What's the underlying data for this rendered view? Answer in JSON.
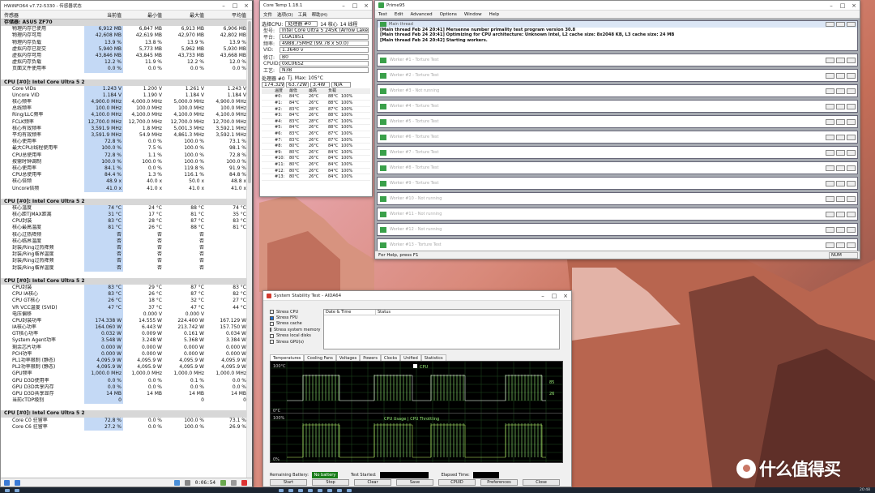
{
  "hwinfo": {
    "title": "HWiNFO64 v7.72-5330 - 传感器状态",
    "columns": [
      "传感器",
      "当前值",
      "最小值",
      "最大值",
      "平均值"
    ],
    "rows": [
      {
        "type": "sec",
        "cells": [
          "存储器: ASUS ZF70",
          "",
          "",
          "",
          ""
        ]
      },
      {
        "cells": [
          "物理内存已使用",
          "6,912 MB",
          "6,847 MB",
          "6,913 MB",
          "6,906 MB"
        ]
      },
      {
        "cells": [
          "物理内存可用",
          "42,608 MB",
          "42,619 MB",
          "42,970 MB",
          "42,802 MB"
        ]
      },
      {
        "cells": [
          "物理内存负载",
          "13.9 %",
          "13.8 %",
          "13.9 %",
          "13.9 %"
        ]
      },
      {
        "cells": [
          "虚拟内存已提交",
          "5,940 MB",
          "5,773 MB",
          "5,962 MB",
          "5,930 MB"
        ]
      },
      {
        "cells": [
          "虚拟内存可用",
          "43,846 MB",
          "43,845 MB",
          "43,733 MB",
          "43,668 MB"
        ]
      },
      {
        "cells": [
          "虚拟内存负载",
          "12.2 %",
          "11.9 %",
          "12.2 %",
          "12.0 %"
        ]
      },
      {
        "cells": [
          "页面文件使用率",
          "0.0 %",
          "0.0 %",
          "0.0 %",
          "0.0 %"
        ]
      },
      {
        "type": "blank",
        "cells": [
          "",
          "",
          "",
          "",
          ""
        ]
      },
      {
        "type": "sec",
        "cells": [
          "CPU [#0]: Intel Core Ultra 5 245K",
          "",
          "",
          "",
          ""
        ]
      },
      {
        "cells": [
          "Core VIDs",
          "1.243 V",
          "1.200 V",
          "1.261 V",
          "1.243 V"
        ]
      },
      {
        "cells": [
          "Uncore VID",
          "1.184 V",
          "1.190 V",
          "1.184 V",
          "1.184 V"
        ]
      },
      {
        "cells": [
          "核心频率",
          "4,900.0 MHz",
          "4,000.0 MHz",
          "5,000.0 MHz",
          "4,900.0 MHz"
        ]
      },
      {
        "cells": [
          "总线频率",
          "100.0 MHz",
          "100.0 MHz",
          "100.0 MHz",
          "100.0 MHz"
        ]
      },
      {
        "cells": [
          "Ring/LLC频率",
          "4,100.0 MHz",
          "4,100.0 MHz",
          "4,100.0 MHz",
          "4,100.0 MHz"
        ]
      },
      {
        "cells": [
          "FCLK频率",
          "12,700.0 MHz",
          "12,700.0 MHz",
          "12,700.0 MHz",
          "12,700.0 MHz"
        ]
      },
      {
        "cells": [
          "核心有效频率",
          "3,591.9 MHz",
          "1.8 MHz",
          "5,001.3 MHz",
          "3,592.1 MHz"
        ]
      },
      {
        "cells": [
          "平均有效频率",
          "3,591.9 MHz",
          "54.9 MHz",
          "4,861.3 MHz",
          "3,592.1 MHz"
        ]
      },
      {
        "cells": [
          "核心使用率",
          "72.8 %",
          "0.0 %",
          "100.0 %",
          "73.1 %"
        ]
      },
      {
        "cells": [
          "最大CPU/线程使用率",
          "100.0 %",
          "7.5 %",
          "100.0 %",
          "98.1 %"
        ]
      },
      {
        "cells": [
          "CPU总使用率",
          "72.8 %",
          "1.1 %",
          "100.0 %",
          "72.8 %"
        ]
      },
      {
        "cells": [
          "按需时钟调制",
          "100.0 %",
          "100.0 %",
          "100.0 %",
          "100.0 %"
        ]
      },
      {
        "cells": [
          "核心使用率",
          "84.1 %",
          "0.0 %",
          "119.8 %",
          "91.9 %"
        ]
      },
      {
        "cells": [
          "CPU总使用率",
          "84.4 %",
          "1.3 %",
          "116.1 %",
          "84.8 %"
        ]
      },
      {
        "cells": [
          "核心倍频",
          "48.9 x",
          "40.0 x",
          "50.0 x",
          "48.8 x"
        ]
      },
      {
        "cells": [
          "Uncore倍频",
          "41.0 x",
          "41.0 x",
          "41.0 x",
          "41.0 x"
        ]
      },
      {
        "type": "blank",
        "cells": [
          "",
          "",
          "",
          "",
          ""
        ]
      },
      {
        "type": "sec",
        "cells": [
          "CPU [#0]: Intel Core Ultra 5 245K: DTS",
          "",
          "",
          "",
          ""
        ]
      },
      {
        "cells": [
          "核心温度",
          "74 °C",
          "24 °C",
          "88 °C",
          "74 °C"
        ]
      },
      {
        "cells": [
          "核心距TjMAX距离",
          "31 °C",
          "17 °C",
          "81 °C",
          "35 °C"
        ]
      },
      {
        "cells": [
          "CPU封装",
          "83 °C",
          "28 °C",
          "87 °C",
          "83 °C"
        ]
      },
      {
        "cells": [
          "核心最高温度",
          "81 °C",
          "26 °C",
          "88 °C",
          "81 °C"
        ]
      },
      {
        "cells": [
          "核心过热降频",
          "否",
          "否",
          "否",
          ""
        ]
      },
      {
        "cells": [
          "核心临界温度",
          "否",
          "否",
          "否",
          ""
        ]
      },
      {
        "cells": [
          "封装/Ring过热降频",
          "否",
          "否",
          "否",
          ""
        ]
      },
      {
        "cells": [
          "封装/Ring临界温度",
          "否",
          "否",
          "否",
          ""
        ]
      },
      {
        "cells": [
          "封装/Ring过热降频",
          "否",
          "否",
          "否",
          ""
        ]
      },
      {
        "cells": [
          "封装/Ring临界温度",
          "否",
          "否",
          "否",
          ""
        ]
      },
      {
        "type": "blank",
        "cells": [
          "",
          "",
          "",
          "",
          ""
        ]
      },
      {
        "type": "sec",
        "cells": [
          "CPU [#0]: Intel Core Ultra 5 245K: Enhanced",
          "",
          "",
          "",
          ""
        ]
      },
      {
        "cells": [
          "CPU封装",
          "83 °C",
          "29 °C",
          "87 °C",
          "83 °C"
        ]
      },
      {
        "cells": [
          "CPU IA核心",
          "83 °C",
          "26 °C",
          "87 °C",
          "82 °C"
        ]
      },
      {
        "cells": [
          "CPU GT核心",
          "26 °C",
          "18 °C",
          "32 °C",
          "27 °C"
        ]
      },
      {
        "cells": [
          "VR VCC温度 (SVID)",
          "47 °C",
          "37 °C",
          "47 °C",
          "44 °C"
        ]
      },
      {
        "cells": [
          "电压偏移",
          "",
          "0.000 V",
          "0.000 V",
          ""
        ]
      },
      {
        "cells": [
          "CPU封装功率",
          "174.338 W",
          "14.555 W",
          "224.400 W",
          "167.129 W"
        ]
      },
      {
        "cells": [
          "IA核心功率",
          "164.060 W",
          "6.443 W",
          "213.742 W",
          "157.750 W"
        ]
      },
      {
        "cells": [
          "GT核心功率",
          "0.032 W",
          "0.009 W",
          "0.161 W",
          "0.034 W"
        ]
      },
      {
        "cells": [
          "System Agent功率",
          "3.548 W",
          "3.248 W",
          "5.368 W",
          "3.384 W"
        ]
      },
      {
        "cells": [
          "剩余芯片功率",
          "0.000 W",
          "0.000 W",
          "0.000 W",
          "0.000 W"
        ]
      },
      {
        "cells": [
          "PCH功率",
          "0.000 W",
          "0.000 W",
          "0.000 W",
          "0.000 W"
        ]
      },
      {
        "cells": [
          "PL1功率限制 (静态)",
          "4,095.9 W",
          "4,095.9 W",
          "4,095.9 W",
          "4,095.9 W"
        ]
      },
      {
        "cells": [
          "PL2功率限制 (静态)",
          "4,095.9 W",
          "4,095.9 W",
          "4,095.9 W",
          "4,095.9 W"
        ]
      },
      {
        "cells": [
          "GPU频率",
          "1,000.0 MHz",
          "1,000.0 MHz",
          "1,000.0 MHz",
          "1,000.0 MHz"
        ]
      },
      {
        "cells": [
          "GPU D3D使用率",
          "0.0 %",
          "0.0 %",
          "0.1 %",
          "0.0 %"
        ]
      },
      {
        "cells": [
          "GPU D3D共享内存",
          "0.0 %",
          "0.0 %",
          "0.0 %",
          "0.0 %"
        ]
      },
      {
        "cells": [
          "GPU D3D共享显存",
          "14 MB",
          "14 MB",
          "14 MB",
          "14 MB"
        ]
      },
      {
        "cells": [
          "当前cTDP级别",
          "0",
          "",
          "0",
          "0"
        ]
      },
      {
        "type": "blank",
        "cells": [
          "",
          "",
          "",
          "",
          ""
        ]
      },
      {
        "type": "sec",
        "cells": [
          "CPU [#0]: Intel Core Ultra 5 245K: C-State驻留率",
          "",
          "",
          "",
          ""
        ]
      },
      {
        "cells": [
          "Core C0 驻留率",
          "72.8 %",
          "0.0 %",
          "100.0 %",
          "73.1 %"
        ]
      },
      {
        "cells": [
          "Core C6 驻留率",
          "27.2 %",
          "0.0 %",
          "100.0 %",
          "26.9 %"
        ]
      }
    ],
    "footer_time": "0:06:54"
  },
  "cpuz": {
    "title": "Core Temp 1.18.1",
    "menu": [
      "文件",
      "选项(O)",
      "工具",
      "帮助(H)"
    ],
    "select_label": "选择CPU:",
    "select_value": "处理器 #0",
    "cores_label": "14 核心",
    "threads_label": "14 线程",
    "info": [
      {
        "label": "型号:",
        "value": "Intel Core Ultra 5 245K (Arrow Lake)"
      },
      {
        "label": "平台:",
        "value": "LGA1851"
      },
      {
        "label": "频率:",
        "value": "4988.75MHz (99.78 x 50.0)"
      },
      {
        "label": "VID:",
        "value": "1.3640 v"
      },
      {
        "label": "修订:",
        "value": "B0"
      },
      {
        "label": "CPUID:",
        "value": "0xC0652"
      },
      {
        "label": "工艺:",
        "value": "N3B"
      }
    ],
    "tjmax_label": "处理器 #0",
    "tjmax_value": "Tj. Max: 105°C",
    "power": [
      "174.32W",
      "63.72W",
      "3.4W",
      "N/A"
    ],
    "temp_headers": [
      "",
      "温度",
      "最低",
      "最高",
      "负载",
      ""
    ],
    "temps": [
      [
        "",
        "#0:",
        "84°C",
        "26°C",
        "88°C",
        "100%"
      ],
      [
        "",
        "#1:",
        "84°C",
        "26°C",
        "88°C",
        "100%"
      ],
      [
        "",
        "#2:",
        "83°C",
        "28°C",
        "87°C",
        "100%"
      ],
      [
        "",
        "#3:",
        "84°C",
        "26°C",
        "88°C",
        "100%"
      ],
      [
        "",
        "#4:",
        "83°C",
        "28°C",
        "87°C",
        "100%"
      ],
      [
        "",
        "#5:",
        "84°C",
        "26°C",
        "88°C",
        "100%"
      ],
      [
        "",
        "#6:",
        "83°C",
        "26°C",
        "87°C",
        "100%"
      ],
      [
        "",
        "#7:",
        "83°C",
        "26°C",
        "87°C",
        "100%"
      ],
      [
        "",
        "#8:",
        "80°C",
        "26°C",
        "84°C",
        "100%"
      ],
      [
        "",
        "#9:",
        "80°C",
        "26°C",
        "84°C",
        "100%"
      ],
      [
        "",
        "#10:",
        "80°C",
        "26°C",
        "84°C",
        "100%"
      ],
      [
        "",
        "#11:",
        "80°C",
        "26°C",
        "84°C",
        "100%"
      ],
      [
        "",
        "#12:",
        "80°C",
        "26°C",
        "84°C",
        "100%"
      ],
      [
        "",
        "#13:",
        "80°C",
        "26°C",
        "84°C",
        "100%"
      ]
    ]
  },
  "prime95": {
    "title": "Prime95",
    "menu": [
      "Test",
      "Edit",
      "Advanced",
      "Options",
      "Window",
      "Help"
    ],
    "main_title": "Main thread",
    "main_lines": [
      "[Main thread Feb 24 20:41] Mersenne number primality test program version 30.8",
      "[Main thread Feb 24 20:41] Optimizing for CPU architecture: Unknown Intel, L2 cache size: 8x2048 KB, L3 cache size: 24 MB",
      "[Main thread Feb 24 20:42] Starting workers."
    ],
    "workers": [
      "Worker #1 - Torture Test",
      "Worker #2 - Torture Test",
      "Worker #3 - Not running",
      "Worker #4 - Torture Test",
      "Worker #5 - Torture Test",
      "Worker #6 - Torture Test",
      "Worker #7 - Torture Test",
      "Worker #8 - Torture Test",
      "Worker #9 - Torture Test",
      "Worker #10 - Not running",
      "Worker #11 - Not running",
      "Worker #12 - Not running",
      "Worker #13 - Torture Test",
      "Worker #14 - Torture Test"
    ],
    "status": "For Help, press F1",
    "num": "NUM"
  },
  "aida": {
    "title": "System Stability Test - AIDA64",
    "checks": [
      {
        "label": "Stress CPU",
        "on": false
      },
      {
        "label": "Stress FPU",
        "on": true
      },
      {
        "label": "Stress cache",
        "on": false
      },
      {
        "label": "Stress system memory",
        "on": false
      },
      {
        "label": "Stress local disks",
        "on": false
      },
      {
        "label": "Stress GPU(s)",
        "on": false
      }
    ],
    "log_headers": [
      "Date & Time",
      "Status"
    ],
    "tabs": [
      "Temperatures",
      "Cooling Fans",
      "Voltages",
      "Powers",
      "Clocks",
      "Unified",
      "Statistics"
    ],
    "temp_legend": "CPU",
    "usage_legend": "CPU Usage | CPU Throttling",
    "y_top": "100°C",
    "y_bottom": "0°C",
    "y2_top": "100%",
    "y2_bottom": "0%",
    "right_top": "85",
    "right_bot": "26",
    "battery_label": "Remaining Battery:",
    "battery_value": "No battery",
    "started_label": "Test Started:",
    "elapsed_label": "Elapsed Time:",
    "buttons": [
      "Start",
      "Stop",
      "Clear",
      "Save",
      "CPUID",
      "Preferences",
      "Close"
    ]
  },
  "watermark": "什么值得买",
  "taskbar_time": "20:48"
}
